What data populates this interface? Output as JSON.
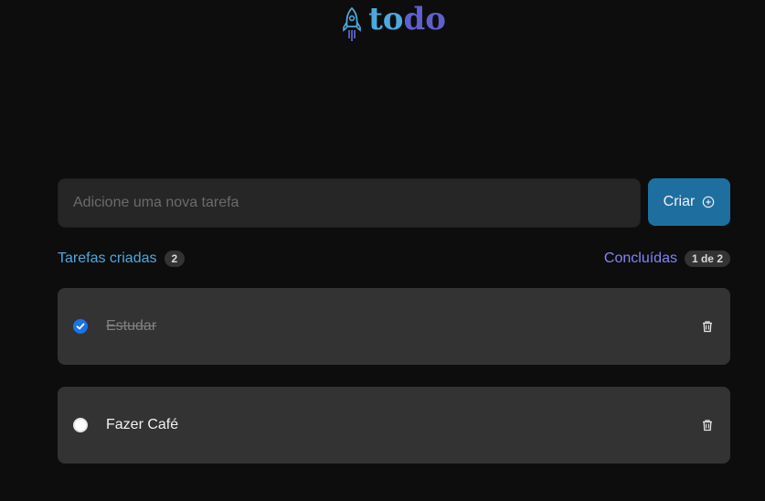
{
  "header": {
    "logo_part1": "to",
    "logo_part2": "do",
    "logo_icon": "rocket-icon"
  },
  "form": {
    "placeholder": "Adicione uma nova tarefa",
    "value": "",
    "create_label": "Criar",
    "create_icon": "plus-circle-icon"
  },
  "counters": {
    "created_label": "Tarefas criadas",
    "created_count": "2",
    "done_label": "Concluídas",
    "done_count": "1 de 2"
  },
  "tasks": [
    {
      "text": "Estudar",
      "done": true
    },
    {
      "text": "Fazer Café",
      "done": false
    }
  ],
  "colors": {
    "background": "#0d0d0d",
    "surface": "#333333",
    "input": "#262626",
    "blue": "#4ea8de",
    "blue_dark": "#1e6f9f",
    "purple": "#8284fa",
    "purple_dark": "#5e60ce"
  }
}
